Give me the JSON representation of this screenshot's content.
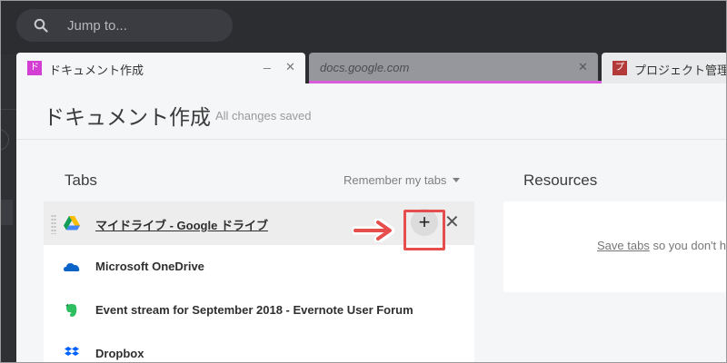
{
  "search": {
    "placeholder": "Jump to..."
  },
  "browser_tabs": [
    {
      "title": "ドキュメント作成",
      "favicon": "ド",
      "active": true
    },
    {
      "title": "docs.google.com",
      "favicon": "",
      "active": false
    },
    {
      "title": "プロジェクト管理",
      "favicon": "プ",
      "active": false
    }
  ],
  "page": {
    "title": "ドキュメント作成",
    "status": "All changes saved"
  },
  "tabs_section": {
    "heading": "Tabs",
    "remember_label": "Remember my tabs",
    "items": [
      {
        "title": "マイドライブ - Google ドライブ",
        "icon": "google-drive-icon",
        "add_label": "+",
        "close_label": "✕"
      },
      {
        "title": "Microsoft OneDrive",
        "icon": "onedrive-icon"
      },
      {
        "title": "Event stream for September 2018 - Evernote User Forum",
        "icon": "evernote-icon"
      },
      {
        "title": "Dropbox",
        "icon": "dropbox-icon"
      }
    ]
  },
  "resources_section": {
    "heading": "Resources",
    "save_link": "Save tabs",
    "save_suffix": " so you don't ha"
  },
  "colors": {
    "accent_pink": "#d95bd9",
    "annotation_red": "#e64d4d"
  }
}
